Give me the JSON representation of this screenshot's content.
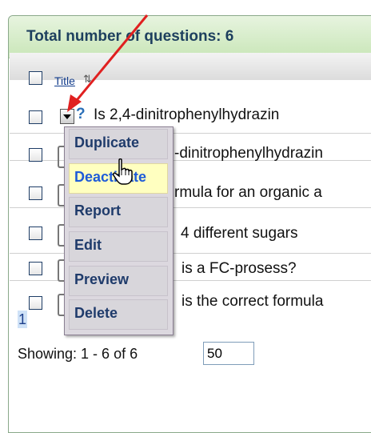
{
  "header": {
    "title": "Total number of questions: 6"
  },
  "table": {
    "column_title": "Title",
    "rows": [
      {
        "text": "Is 2,4-dinitrophenylhydrazin"
      },
      {
        "text": "-dinitrophenylhydrazin"
      },
      {
        "text": "rmula for an organic a"
      },
      {
        "text": "4 different sugars"
      },
      {
        "text": "is a FC-prosess?"
      },
      {
        "text": "is the correct formula"
      }
    ]
  },
  "menu": {
    "items": [
      "Duplicate",
      "Deactivate",
      "Report",
      "Edit",
      "Preview",
      "Delete"
    ],
    "highlighted": "Deactivate"
  },
  "pagination": {
    "current_page": "1",
    "showing_text": "Showing: 1 - 6 of 6",
    "page_size": "50"
  },
  "colors": {
    "header_bg": "#c9e6b8",
    "menu_bg": "#d8d6db",
    "highlight_bg": "#ffffc0",
    "arrow": "#e02020"
  }
}
